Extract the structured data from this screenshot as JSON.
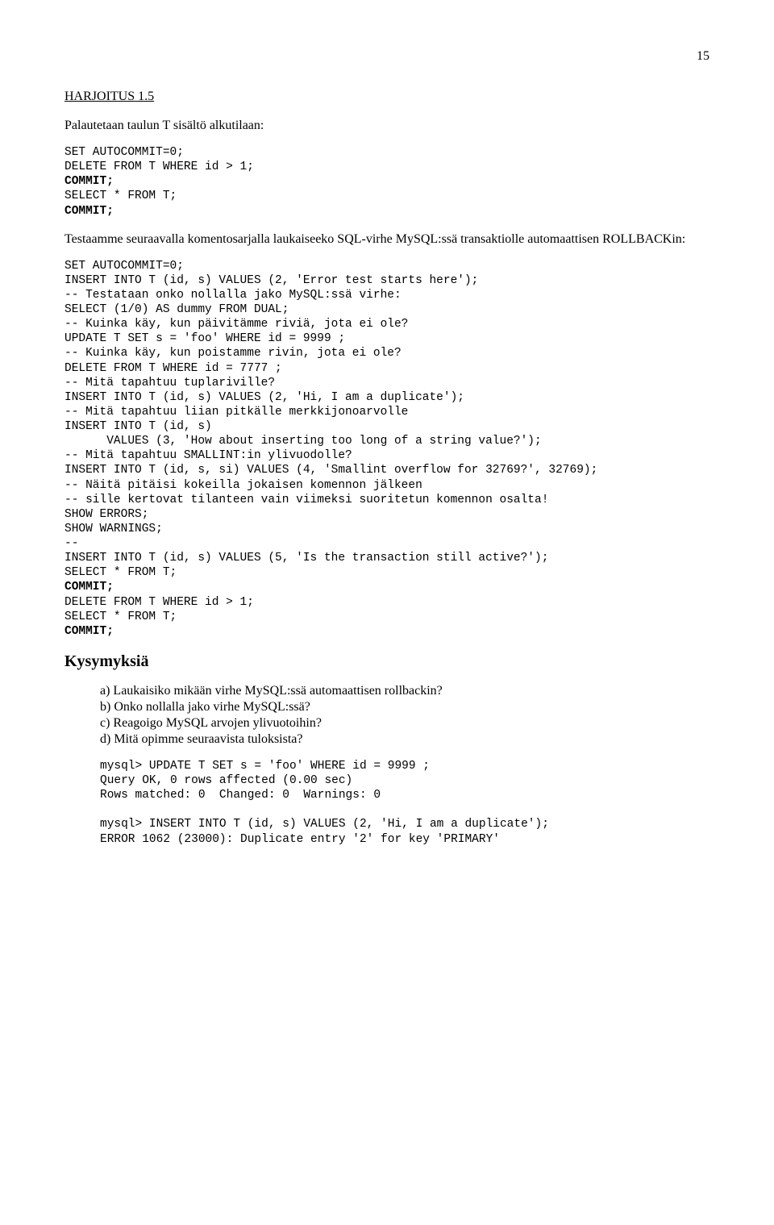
{
  "page_number": "15",
  "heading": "HARJOITUS 1.5",
  "intro": "Palautetaan taulun T sisältö alkutilaan:",
  "code1": {
    "l1": "SET AUTOCOMMIT=0;",
    "l2": "DELETE FROM T WHERE id > 1;",
    "l3": "COMMIT;",
    "l4": "SELECT * FROM T;",
    "l5": "COMMIT;"
  },
  "mid1": "Testaamme seuraavalla komentosarjalla laukaiseeko SQL-virhe MySQL:ssä transaktiolle automaattisen ROLLBACKin:",
  "code2": {
    "l01": "SET AUTOCOMMIT=0;",
    "l02": "INSERT INTO T (id, s) VALUES (2, 'Error test starts here');",
    "l03": "-- Testataan onko nollalla jako MySQL:ssä virhe:",
    "l04": "SELECT (1/0) AS dummy FROM DUAL;",
    "l05": "-- Kuinka käy, kun päivitämme riviä, jota ei ole?",
    "l06": "UPDATE T SET s = 'foo' WHERE id = 9999 ;",
    "l07": "-- Kuinka käy, kun poistamme rivin, jota ei ole?",
    "l08": "DELETE FROM T WHERE id = 7777 ;",
    "l09": "-- Mitä tapahtuu tuplariville?",
    "l10": "INSERT INTO T (id, s) VALUES (2, 'Hi, I am a duplicate');",
    "l11": "-- Mitä tapahtuu liian pitkälle merkkijonoarvolle",
    "l12": "INSERT INTO T (id, s)",
    "l13": "      VALUES (3, 'How about inserting too long of a string value?');",
    "l14": "-- Mitä tapahtuu SMALLINT:in ylivuodolle?",
    "l15": "INSERT INTO T (id, s, si) VALUES (4, 'Smallint overflow for 32769?', 32769);",
    "l16": "-- Näitä pitäisi kokeilla jokaisen komennon jälkeen",
    "l17": "-- sille kertovat tilanteen vain viimeksi suoritetun komennon osalta!",
    "l18": "SHOW ERRORS;",
    "l19": "SHOW WARNINGS;",
    "l20": "--",
    "l21": "INSERT INTO T (id, s) VALUES (5, 'Is the transaction still active?');",
    "l22": "SELECT * FROM T;",
    "l23": "COMMIT;",
    "l24": "DELETE FROM T WHERE id > 1;",
    "l25": "SELECT * FROM T;",
    "l26": "COMMIT;"
  },
  "questions_heading": "Kysymyksiä",
  "questions": {
    "a": "a)  Laukaisiko mikään virhe MySQL:ssä automaattisen rollbackin?",
    "b": "b)  Onko nollalla jako virhe MySQL:ssä?",
    "c": "c)  Reagoigo MySQL arvojen ylivuotoihin?",
    "d": "d)  Mitä opimme seuraavista tuloksista?"
  },
  "code3": {
    "l1": "mysql> UPDATE T SET s = 'foo' WHERE id = 9999 ;",
    "l2": "Query OK, 0 rows affected (0.00 sec)",
    "l3": "Rows matched: 0  Changed: 0  Warnings: 0",
    "l4": "",
    "l5": "mysql> INSERT INTO T (id, s) VALUES (2, 'Hi, I am a duplicate');",
    "l6": "ERROR 1062 (23000): Duplicate entry '2' for key 'PRIMARY'"
  }
}
